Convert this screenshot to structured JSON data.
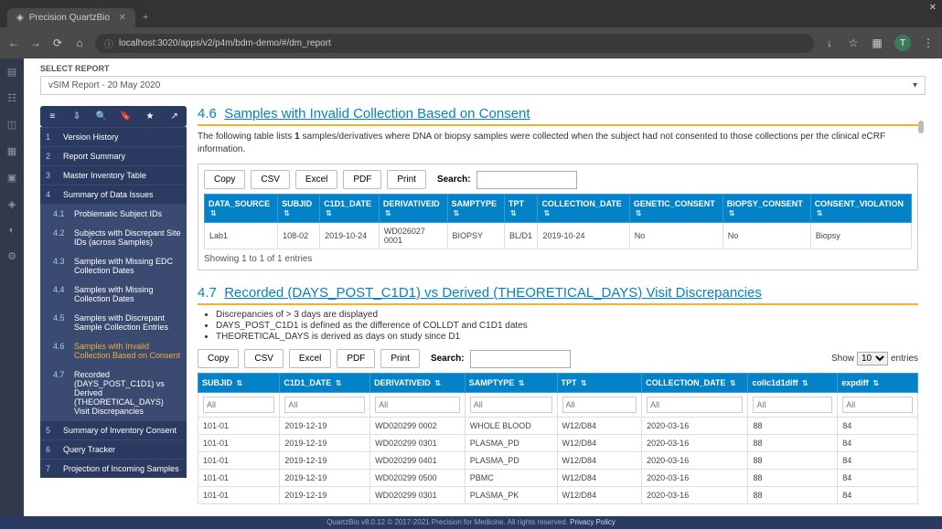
{
  "browser": {
    "tab_title": "Precision QuartzBio",
    "url": "localhost:3020/apps/v2/p4m/bdm-demo/#/dm_report"
  },
  "select_report": {
    "label": "SELECT REPORT",
    "value": "vSIM Report - 20 May 2020"
  },
  "sidebar": {
    "items": [
      {
        "idx": "1",
        "label": "Version History",
        "sub": false
      },
      {
        "idx": "2",
        "label": "Report Summary",
        "sub": false
      },
      {
        "idx": "3",
        "label": "Master Inventory Table",
        "sub": false
      },
      {
        "idx": "4",
        "label": "Summary of Data Issues",
        "sub": false
      },
      {
        "idx": "4.1",
        "label": "Problematic Subject IDs",
        "sub": true
      },
      {
        "idx": "4.2",
        "label": "Subjects with Discrepant Site IDs (across Samples)",
        "sub": true
      },
      {
        "idx": "4.3",
        "label": "Samples with Missing EDC Collection Dates",
        "sub": true
      },
      {
        "idx": "4.4",
        "label": "Samples with Missing Collection Dates",
        "sub": true
      },
      {
        "idx": "4.5",
        "label": "Samples with Discrepant Sample Collection Entries",
        "sub": true
      },
      {
        "idx": "4.6",
        "label": "Samples with Invalid Collection Based on Consent",
        "sub": true,
        "active": true
      },
      {
        "idx": "4.7",
        "label": "Recorded (DAYS_POST_C1D1) vs Derived (THEORETICAL_DAYS) Visit Discrepancies",
        "sub": true
      },
      {
        "idx": "5",
        "label": "Summary of Inventory Consent",
        "sub": false
      },
      {
        "idx": "6",
        "label": "Query Tracker",
        "sub": false
      },
      {
        "idx": "7",
        "label": "Projection of Incoming Samples",
        "sub": false
      }
    ]
  },
  "section46": {
    "num": "4.6",
    "title": "Samples with Invalid Collection Based on Consent",
    "intro_before": "The following table lists ",
    "intro_bold": "1",
    "intro_after": " samples/derivatives where DNA or biopsy samples were collected when the subject had not consented to those collections per the clinical eCRF information.",
    "buttons": {
      "copy": "Copy",
      "csv": "CSV",
      "excel": "Excel",
      "pdf": "PDF",
      "print": "Print"
    },
    "search_label": "Search:",
    "headers": [
      "DATA_SOURCE",
      "SUBJID",
      "C1D1_DATE",
      "DERIVATIVEID",
      "SAMPTYPE",
      "TPT",
      "COLLECTION_DATE",
      "GENETIC_CONSENT",
      "BIOPSY_CONSENT",
      "CONSENT_VIOLATION"
    ],
    "rows": [
      [
        "Lab1",
        "108-02",
        "2019-10-24",
        "WD026027 0001",
        "BIOPSY",
        "BL/D1",
        "2019-10-24",
        "No",
        "No",
        "Biopsy"
      ]
    ],
    "info": "Showing 1 to 1 of 1 entries"
  },
  "section47": {
    "num": "4.7",
    "title": "Recorded (DAYS_POST_C1D1) vs Derived (THEORETICAL_DAYS) Visit Discrepancies",
    "bullets": [
      "Discrepancies of > 3 days are displayed",
      "DAYS_POST_C1D1 is defined as the difference of COLLDT and C1D1 dates",
      "THEORETICAL_DAYS is derived as days on study since D1"
    ],
    "buttons": {
      "copy": "Copy",
      "csv": "CSV",
      "excel": "Excel",
      "pdf": "PDF",
      "print": "Print"
    },
    "search_label": "Search:",
    "show_label": "Show",
    "show_value": "10",
    "entries_label": "entries",
    "headers": [
      "SUBJID",
      "C1D1_DATE",
      "DERIVATIVEID",
      "SAMPTYPE",
      "TPT",
      "COLLECTION_DATE",
      "collc1d1diff",
      "expdiff"
    ],
    "filter_placeholder": "All",
    "rows": [
      [
        "101-01",
        "2019-12-19",
        "WD020299 0002",
        "WHOLE BLOOD",
        "W12/D84",
        "2020-03-16",
        "88",
        "84"
      ],
      [
        "101-01",
        "2019-12-19",
        "WD020299 0301",
        "PLASMA_PD",
        "W12/D84",
        "2020-03-16",
        "88",
        "84"
      ],
      [
        "101-01",
        "2019-12-19",
        "WD020299 0401",
        "PLASMA_PD",
        "W12/D84",
        "2020-03-16",
        "88",
        "84"
      ],
      [
        "101-01",
        "2019-12-19",
        "WD020299 0500",
        "PBMC",
        "W12/D84",
        "2020-03-16",
        "88",
        "84"
      ],
      [
        "101-01",
        "2019-12-19",
        "WD020299 0301",
        "PLASMA_PK",
        "W12/D84",
        "2020-03-16",
        "88",
        "84"
      ]
    ]
  },
  "footer": {
    "text": "QuartzBio v8.0.12 © 2017-2021 Precision for Medicine. All rights reserved. ",
    "link": "Privacy Policy"
  }
}
